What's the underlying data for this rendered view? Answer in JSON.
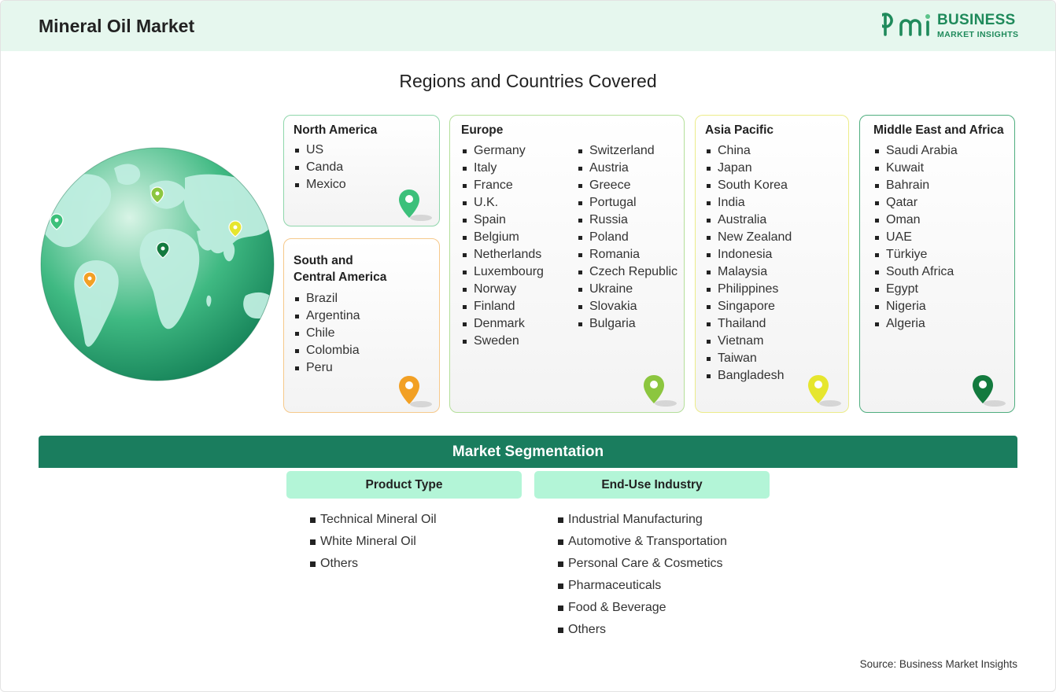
{
  "header": {
    "title": "Mineral Oil Market",
    "logo": {
      "word1": "BUSINESS",
      "word2": "MARKET INSIGHTS",
      "mark": "bmi"
    }
  },
  "regions": {
    "title": "Regions and Countries Covered",
    "north_america": {
      "title": "North America",
      "items": [
        "US",
        "Canda",
        "Mexico"
      ],
      "pin_color": "#3cc07a"
    },
    "south_central_america": {
      "title_line1": "South and",
      "title_line2": "Central America",
      "items": [
        "Brazil",
        "Argentina",
        "Chile",
        "Colombia",
        "Peru"
      ],
      "pin_color": "#f2a024"
    },
    "europe": {
      "title": "Europe",
      "items_col1": [
        "Germany",
        "Italy",
        "France",
        "U.K.",
        "Spain",
        "Belgium",
        "Netherlands",
        "Luxembourg",
        "Norway",
        "Finland",
        "Denmark",
        "Sweden"
      ],
      "items_col2": [
        "Switzerland",
        "Austria",
        "Greece",
        "Portugal",
        "Russia",
        "Poland",
        "Romania",
        "Czech Republic",
        "Ukraine",
        "Slovakia",
        "Bulgaria"
      ],
      "pin_color": "#8cc63f"
    },
    "asia_pacific": {
      "title": "Asia Pacific",
      "items": [
        "China",
        "Japan",
        "South Korea",
        "India",
        "Australia",
        "New Zealand",
        "Indonesia",
        "Malaysia",
        "Philippines",
        "Singapore",
        "Thailand",
        "Vietnam",
        "Taiwan",
        "Bangladesh"
      ],
      "pin_color": "#e6e62e"
    },
    "middle_east_africa": {
      "title": "Middle East and Africa",
      "items": [
        "Saudi Arabia",
        "Kuwait",
        "Bahrain",
        "Qatar",
        "Oman",
        "UAE",
        "Türkiye",
        "South Africa",
        "Egypt",
        "Nigeria",
        "Algeria"
      ],
      "pin_color": "#137a3e"
    }
  },
  "segmentation": {
    "title": "Market Segmentation",
    "product_type": {
      "title": "Product Type",
      "items": [
        "Technical Mineral Oil",
        "White Mineral Oil",
        "Others"
      ]
    },
    "end_use": {
      "title": "End-Use Industry",
      "items": [
        "Industrial Manufacturing",
        "Automotive & Transportation",
        "Personal Care & Cosmetics",
        "Pharmaceuticals",
        "Food & Beverage",
        "Others"
      ]
    }
  },
  "source": "Source: Business Market Insights",
  "colors": {
    "header_bg": "#e6f7ee",
    "brand_green": "#1f8a5b",
    "segment_bar": "#1a7d5e",
    "segment_head": "#b3f5d7"
  }
}
